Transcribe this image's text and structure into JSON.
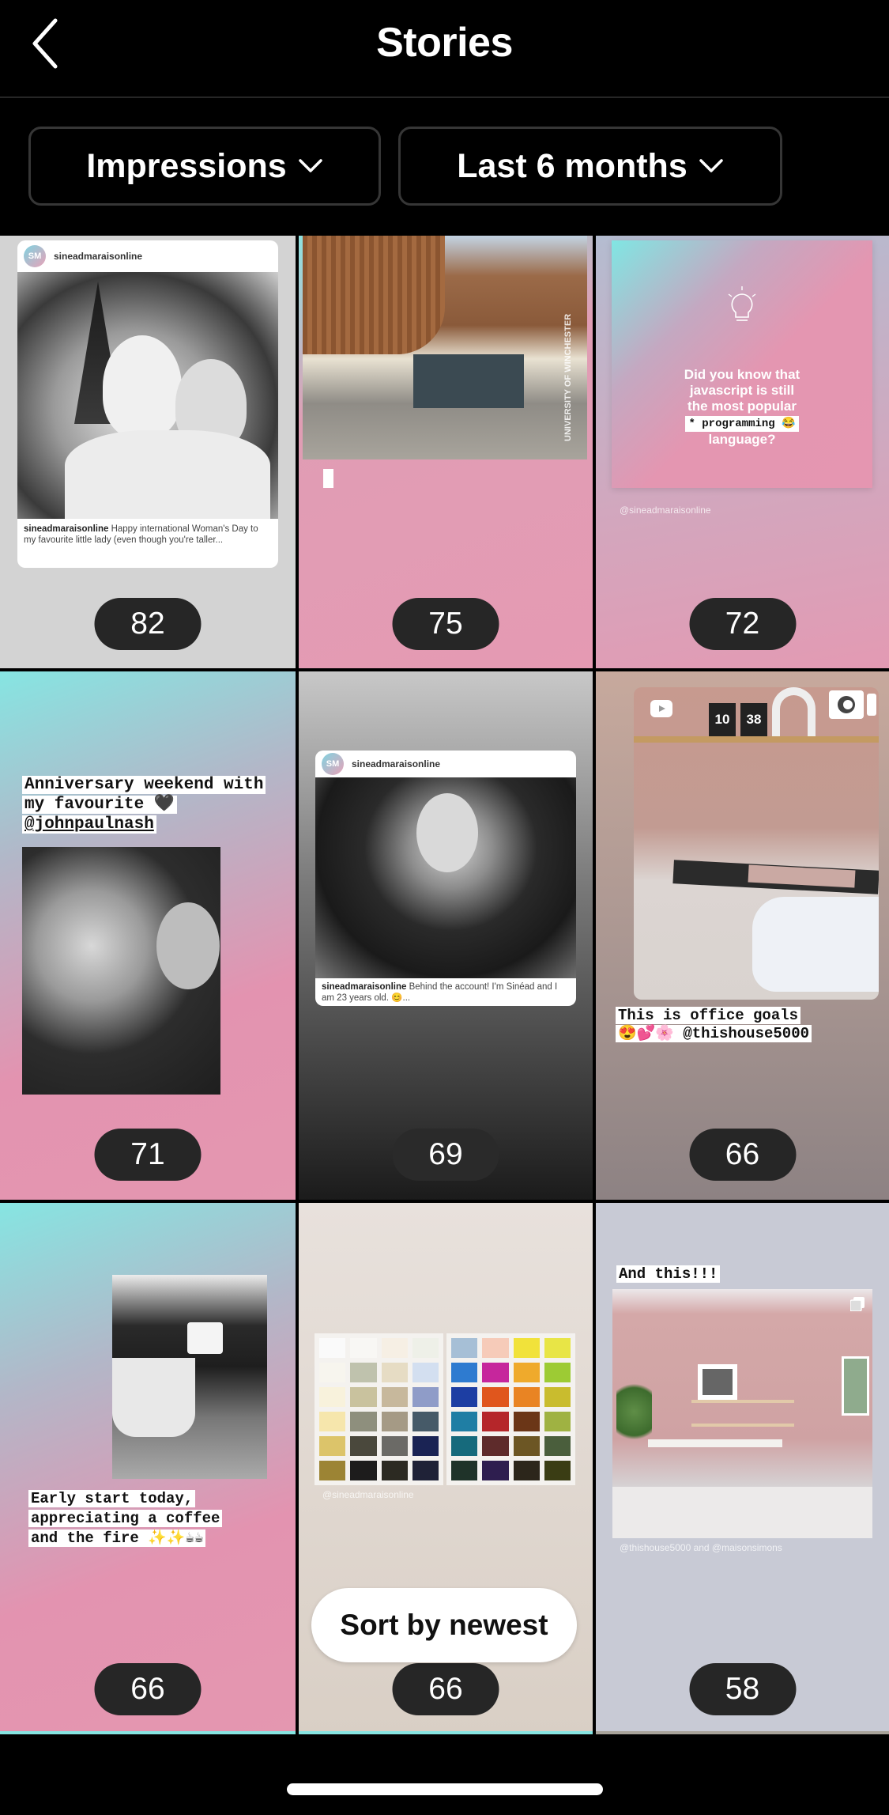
{
  "header": {
    "title": "Stories",
    "back_icon": "chevron-left-icon"
  },
  "filters": {
    "metric": {
      "label": "Impressions",
      "icon": "chevron-down-icon"
    },
    "period": {
      "label": "Last 6 months",
      "icon": "chevron-down-icon"
    }
  },
  "stories": [
    {
      "impressions": "82",
      "type": "shared-post",
      "username": "sineadmaraisonline",
      "avatar_text": "SM",
      "caption_user": "sineadmaraisonline",
      "caption_text": " Happy international Woman's Day to my favourite little lady (even though you're taller..."
    },
    {
      "impressions": "75",
      "type": "photo",
      "location_sticker": "UNIVERSITY OF WINCHESTER"
    },
    {
      "impressions": "72",
      "type": "text-post",
      "text_lines": [
        "Did you know that",
        "javascript is still",
        "the most popular"
      ],
      "highlight": "* programming 😂",
      "text_last": "language?",
      "watermark": "@sineadmaraisonline",
      "icon": "lightbulb-icon"
    },
    {
      "impressions": "71",
      "type": "photo",
      "caption_lines": [
        "Anniversary weekend with",
        "my favourite 🖤",
        "@johnpaulnash"
      ]
    },
    {
      "impressions": "69",
      "type": "shared-post",
      "username": "sineadmaraisonline",
      "avatar_text": "SM",
      "caption_user": "sineadmaraisonline",
      "caption_text": " Behind the account! I'm Sinéad and I am 23 years old. 😊..."
    },
    {
      "impressions": "66",
      "type": "shared-reel",
      "clock": [
        "10",
        "38"
      ],
      "caption_lines": [
        "This is office goals",
        "😍💕🌸 @thishouse5000"
      ]
    },
    {
      "impressions": "66",
      "type": "photo",
      "caption_lines": [
        "Early start today,",
        "appreciating a coffee",
        "and the fire ✨✨☕☕"
      ]
    },
    {
      "impressions": "66",
      "type": "photo",
      "watermark": "@sineadmaraisonline"
    },
    {
      "impressions": "58",
      "type": "shared-post",
      "caption_lines": [
        "And this!!!"
      ],
      "watermark": "@thishouse5000 and @maisonsimons"
    }
  ],
  "sort_button": {
    "label": "Sort by newest"
  },
  "colors": {
    "background": "#000000",
    "badge": "#262626",
    "pill_border": "#363636"
  }
}
